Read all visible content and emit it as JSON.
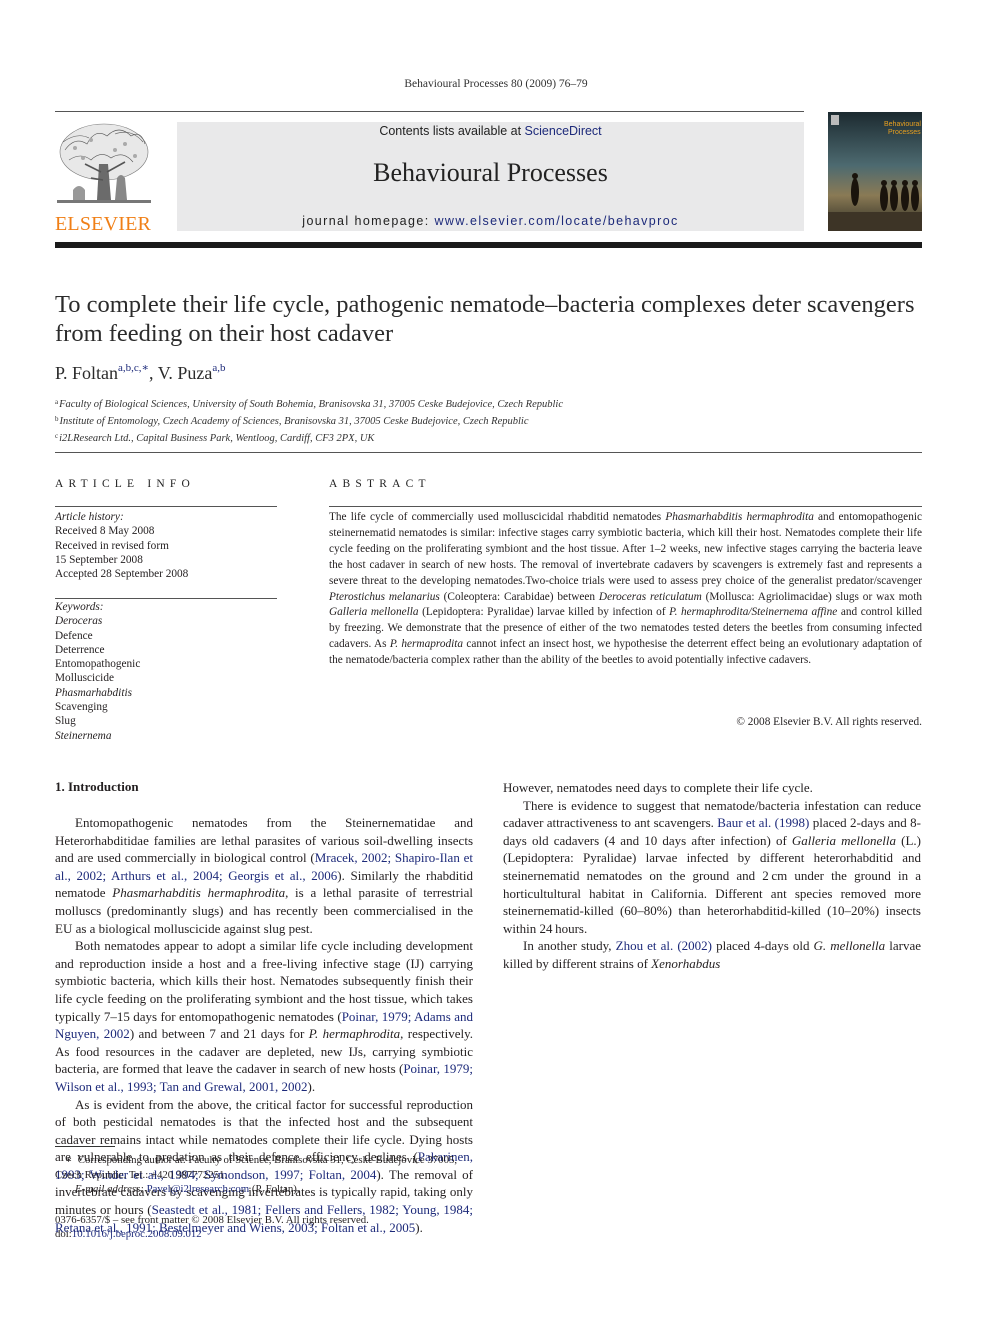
{
  "running_head": "Behavioural Processes 80 (2009) 76–79",
  "masthead": {
    "publisher_logo_text": "ELSEVIER",
    "contents_prefix": "Contents lists available at ",
    "contents_link": "ScienceDirect",
    "journal_title": "Behavioural Processes",
    "homepage_prefix": "journal homepage: ",
    "homepage_link": "www.elsevier.com/locate/behavproc",
    "cover_title_line1": "Behavioural",
    "cover_title_line2": "Processes",
    "colors": {
      "elsevier_orange": "#f07f16",
      "link_blue": "#1d2a7a",
      "banner_gray": "#e9e9ea"
    }
  },
  "article": {
    "title": "To complete their life cycle, pathogenic nematode–bacteria complexes deter scavengers from feeding on their host cadaver",
    "authors": [
      {
        "name": "P. Foltan",
        "marks": "a,b,c,∗"
      },
      {
        "name": "V. Puza",
        "marks": "a,b"
      }
    ],
    "author_separator": ", ",
    "affiliations": [
      {
        "mark": "a",
        "text": "Faculty of Biological Sciences, University of South Bohemia, Branisovska 31, 37005 Ceske Budejovice, Czech Republic"
      },
      {
        "mark": "b",
        "text": "Institute of Entomology, Czech Academy of Sciences, Branisovska 31, 37005 Ceske Budejovice, Czech Republic"
      },
      {
        "mark": "c",
        "text": "i2LResearch Ltd., Capital Business Park, Wentloog, Cardiff, CF3 2PX, UK"
      }
    ]
  },
  "article_info": {
    "heading": "ARTICLE INFO",
    "history_label": "Article history:",
    "history": [
      "Received 8 May 2008",
      "Received in revised form",
      "15 September 2008",
      "Accepted 28 September 2008"
    ],
    "keywords_label": "Keywords:",
    "keywords": [
      {
        "text": "Deroceras",
        "italic": true
      },
      {
        "text": "Defence",
        "italic": false
      },
      {
        "text": "Deterrence",
        "italic": false
      },
      {
        "text": "Entomopathogenic",
        "italic": false
      },
      {
        "text": "Molluscicide",
        "italic": false
      },
      {
        "text": "Phasmarhabditis",
        "italic": true
      },
      {
        "text": "Scavenging",
        "italic": false
      },
      {
        "text": "Slug",
        "italic": false
      },
      {
        "text": "Steinernema",
        "italic": true
      }
    ]
  },
  "abstract": {
    "heading": "ABSTRACT",
    "segments": [
      {
        "t": "The life cycle of commercially used molluscicidal rhabditid nematodes "
      },
      {
        "t": "Phasmarhabditis hermaphrodita",
        "i": true
      },
      {
        "t": " and entomopathogenic steinernematid nematodes is similar: infective stages carry symbiotic bacteria, which kill their host. Nematodes complete their life cycle feeding on the proliferating symbiont and the host tissue. After 1–2 weeks, new infective stages carrying the bacteria leave the host cadaver in search of new hosts. The removal of invertebrate cadavers by scavengers is extremely fast and represents a severe threat to the developing nematodes.Two-choice trials were used to assess prey choice of the generalist predator/scavenger "
      },
      {
        "t": "Pterostichus melanarius",
        "i": true
      },
      {
        "t": " (Coleoptera: Carabidae) between "
      },
      {
        "t": "Deroceras reticulatum",
        "i": true
      },
      {
        "t": " (Mollusca: Agriolimacidae) slugs or wax moth "
      },
      {
        "t": "Galleria mellonella",
        "i": true
      },
      {
        "t": " (Lepidoptera: Pyralidae) larvae killed by infection of "
      },
      {
        "t": "P. hermaphrodita/Steinernema affine",
        "i": true
      },
      {
        "t": " and control killed by freezing. We demonstrate that the presence of either of the two nematodes tested deters the beetles from consuming infected cadavers. As "
      },
      {
        "t": "P. hermaprodita",
        "i": true
      },
      {
        "t": " cannot infect an insect host, we hypothesise the deterrent effect being an evolutionary adaptation of the nematode/bacteria complex rather than the ability of the beetles to avoid potentially infective cadavers."
      }
    ],
    "copyright": "© 2008 Elsevier B.V. All rights reserved."
  },
  "body": {
    "section_heading": "1.  Introduction",
    "paragraphs": [
      {
        "indent": true,
        "segments": [
          {
            "t": "Entomopathogenic nematodes from the Steinernematidae and Heterorhabditidae families are lethal parasites of various soil-dwelling insects and are used commercially in biological control ("
          },
          {
            "t": "Mracek, 2002; Shapiro-Ilan et al., 2002; Arthurs et al., 2004; Georgis et al., 2006",
            "link": true
          },
          {
            "t": "). Similarly the rhabditid nematode "
          },
          {
            "t": "Phasmarhabditis hermaphrodita",
            "i": true
          },
          {
            "t": ", is a lethal parasite of terrestrial molluscs (predominantly slugs) and has recently been commercialised in the EU as a biological molluscicide against slug pest."
          }
        ]
      },
      {
        "indent": true,
        "segments": [
          {
            "t": "Both nematodes appear to adopt a similar life cycle including development and reproduction inside a host and a free-living infective stage (IJ) carrying symbiotic bacteria, which kills their host. Nematodes subsequently finish their life cycle feeding on the proliferating symbiont and the host tissue, which takes typically 7–15 days for entomopathogenic nematodes ("
          },
          {
            "t": "Poinar, 1979; Adams and Nguyen, 2002",
            "link": true
          },
          {
            "t": ") and between 7 and 21 days for "
          },
          {
            "t": "P. hermaphrodita",
            "i": true
          },
          {
            "t": ", respectively. As food resources in the cadaver are depleted, new IJs, carrying symbiotic bacteria, are formed that leave the cadaver in search of new hosts ("
          },
          {
            "t": "Poinar, 1979; Wilson et al., 1993; Tan and Grewal, 2001, 2002",
            "link": true
          },
          {
            "t": ")."
          }
        ]
      },
      {
        "indent": true,
        "segments": [
          {
            "t": "As is evident from the above, the critical factor for successful reproduction of both pesticidal nematodes is that the infected host and the subsequent cadaver remains intact while nematodes complete their life cycle. Dying hosts are vulnerable to predation as their defence efficiency declines ("
          },
          {
            "t": "Pakarinen, 1993; Winder et al., 1994; Symondson, 1997; Foltan, 2004",
            "link": true
          },
          {
            "t": "). The removal of invertebrate cadavers by scavenging invertebrates is typically rapid, taking only minutes or hours ("
          },
          {
            "t": "Seastedt et al., 1981; Fellers and Fellers, 1982; Young, 1984; Retana et al., 1991; Bestelmeyer and Wiens, 2003; Foltan et al., 2005",
            "link": true
          },
          {
            "t": "). However, nematodes need days to complete their life cycle."
          }
        ]
      },
      {
        "indent": true,
        "segments": [
          {
            "t": "There is evidence to suggest that nematode/bacteria infestation can reduce cadaver attractiveness to ant scavengers. "
          },
          {
            "t": "Baur et al. (1998)",
            "link": true
          },
          {
            "t": " placed 2-days and 8-days old cadavers (4 and 10 days after infection) of "
          },
          {
            "t": "Galleria mellonella",
            "i": true
          },
          {
            "t": " (L.)(Lepidoptera: Pyralidae) larvae infected by different heterorhabditid and steinernematid nematodes on the ground and 2 cm under the ground in a horticultultural habitat in California. Different ant species removed more steinernematid-killed (60–80%) than heterorhabditid-killed (10–20%) insects within 24 hours."
          }
        ]
      },
      {
        "indent": true,
        "segments": [
          {
            "t": "In another study, "
          },
          {
            "t": "Zhou et al. (2002)",
            "link": true
          },
          {
            "t": " placed 4-days old "
          },
          {
            "t": "G. mellonella",
            "i": true
          },
          {
            "t": " larvae killed by different strains of "
          },
          {
            "t": "Xenorhabdus",
            "i": true
          }
        ]
      }
    ]
  },
  "footnotes": {
    "corresponding_mark": "∗",
    "corresponding_text": "Corresponding author at: Faculty of Science, Branisovska 31, Ceske Budejovice 37005, Czech Republic. Tel.: +420 387772251.",
    "email_label": "E-mail address: ",
    "email": "Pavel@i2lresearch.com",
    "email_suffix": " (P. Foltan).",
    "front_matter": "0376-6357/$ – see front matter © 2008 Elsevier B.V. All rights reserved.",
    "doi_prefix": "doi:",
    "doi": "10.1016/j.beproc.2008.09.012"
  },
  "icons": {
    "publisher_logo": "elsevier-tree-logo",
    "cover": "journal-cover-meerkats"
  }
}
